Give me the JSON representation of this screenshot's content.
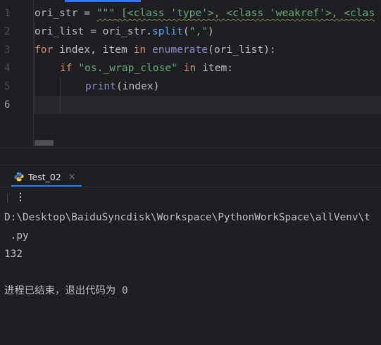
{
  "editor": {
    "line_numbers": [
      "1",
      "2",
      "3",
      "4",
      "5",
      "6"
    ],
    "line1": {
      "var": "ori_str",
      "op": " = ",
      "str": "\"\"\" [<class 'type'>, <class 'weakref'>, <clas"
    },
    "line2": {
      "a": "ori_list = ori_str.",
      "fn": "split",
      "b": "(",
      "str": "\",\"",
      "c": ")"
    },
    "line3": {
      "kw1": "for",
      "a": " index, item ",
      "kw2": "in",
      "sp": " ",
      "builtin": "enumerate",
      "b": "(ori_list):"
    },
    "line4": {
      "kw1": "if",
      "sp": " ",
      "str": "\"os._wrap_close\"",
      "sp2": " ",
      "kw2": "in",
      "a": " item:"
    },
    "line5": {
      "builtin": "print",
      "a": "(index)"
    }
  },
  "run": {
    "tab_label": "Test_02",
    "close_glyph": "×",
    "more_glyph": "⋮"
  },
  "console": {
    "lines": [
      "D:\\Desktop\\BaiduSyncdisk\\Workspace\\PythonWorkSpace\\allVenv\\t",
      " .py",
      "132",
      "",
      "进程已结束，退出代码为 0"
    ]
  },
  "colors": {
    "background": "#1e1f22",
    "keyword": "#cf8e6d",
    "string": "#6aab73",
    "function": "#56a8f5",
    "builtin": "#8888c6",
    "text": "#bcbec4",
    "accent": "#3574f0"
  }
}
